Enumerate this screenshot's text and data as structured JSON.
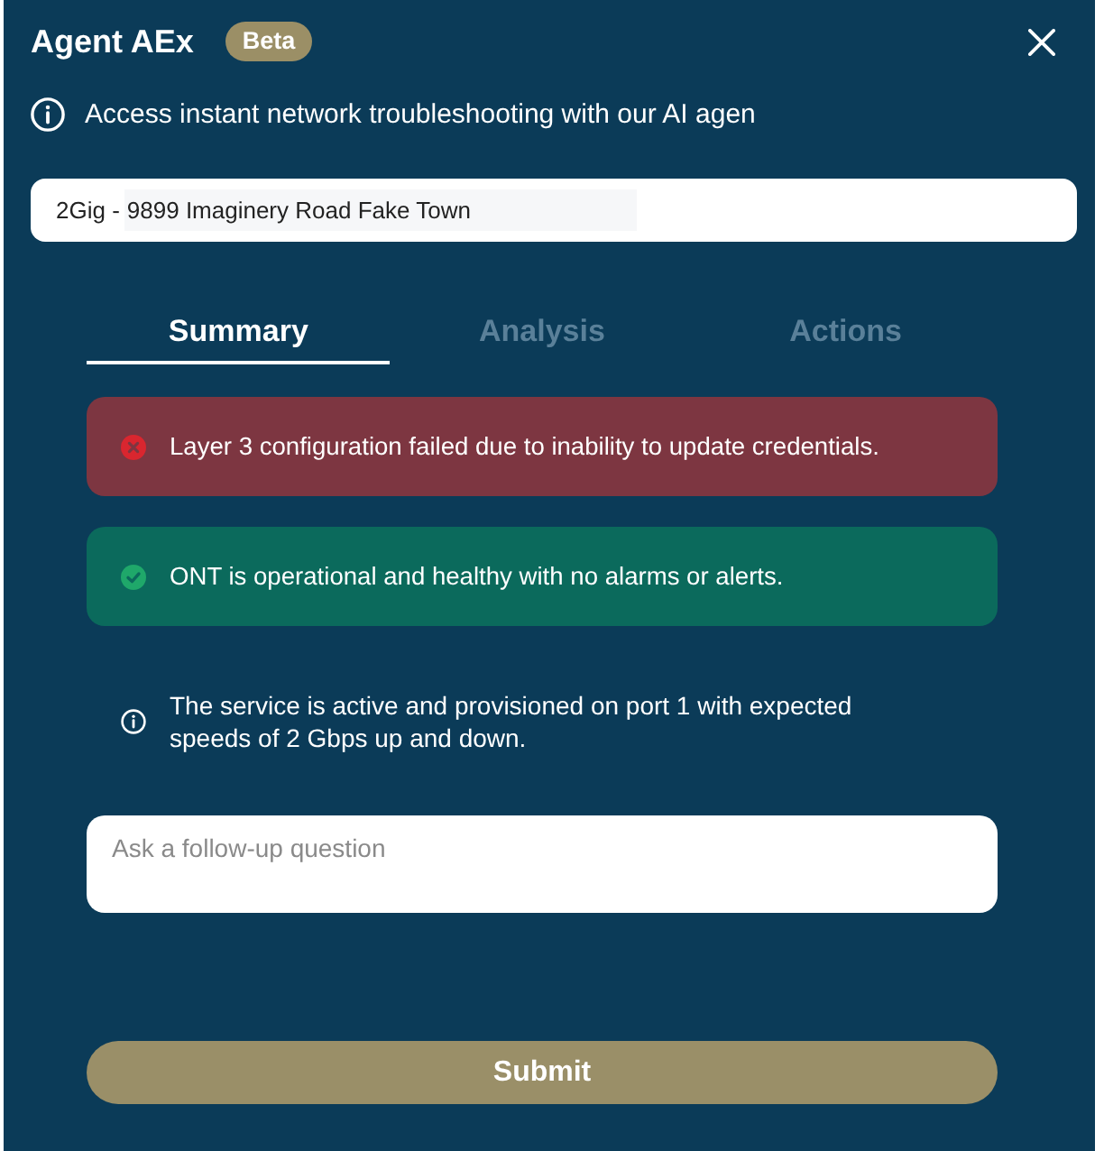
{
  "header": {
    "title": "Agent AEx",
    "badge": "Beta"
  },
  "intro": {
    "text": "Access instant network troubleshooting with our AI agen"
  },
  "address_field": {
    "prefix": "2Gig -",
    "value": "9899 Imaginery Road Fake Town"
  },
  "tabs": [
    {
      "label": "Summary",
      "selected": true
    },
    {
      "label": "Analysis",
      "selected": false
    },
    {
      "label": "Actions",
      "selected": false
    }
  ],
  "messages": [
    {
      "kind": "error",
      "text": "Layer 3 configuration failed due to inability to update credentials."
    },
    {
      "kind": "success",
      "text": "ONT is operational and healthy with no alarms or alerts."
    },
    {
      "kind": "info",
      "text": "The service is active and provisioned on port 1 with expected speeds of 2 Gbps up and down."
    }
  ],
  "question_field": {
    "placeholder": "Ask a follow-up question"
  },
  "submit_button": {
    "label": "Submit"
  }
}
